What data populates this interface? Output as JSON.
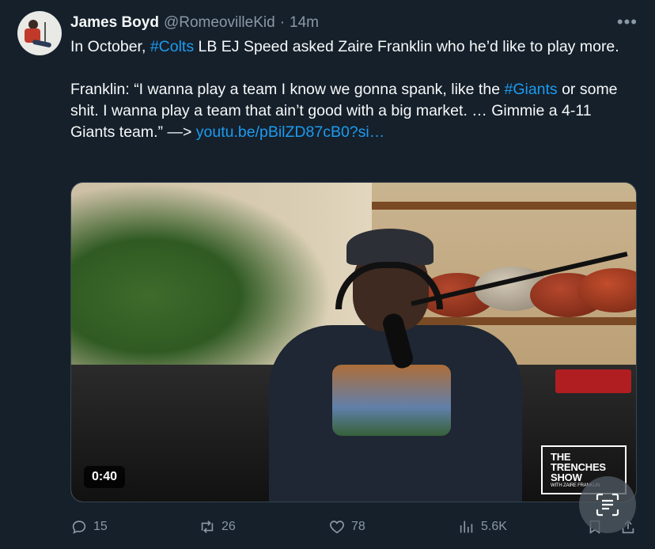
{
  "author": {
    "name": "James Boyd",
    "handle": "@RomeovilleKid",
    "separator": "·",
    "time": "14m"
  },
  "tweet": {
    "line1_prefix": "In October, ",
    "hashtag1": "#Colts",
    "line1_suffix": " LB EJ Speed asked Zaire Franklin who he’d like to play more.",
    "quote_prefix": "Franklin: “I wanna play a team I know we gonna spank, like the ",
    "hashtag2": "#Giants",
    "quote_suffix": " or some shit. I wanna play a team that ain’t good with a big market. … Gimmie a 4-11 Giants team.” —> ",
    "link": "youtu.be/pBilZD87cB0?si…"
  },
  "media": {
    "duration": "0:40",
    "watermark_title": "THE TRENCHES SHOW",
    "watermark_sub": "WITH ZAIRE FRANKLIN"
  },
  "actions": {
    "replies": "15",
    "retweets": "26",
    "likes": "78",
    "views": "5.6K"
  },
  "icons": {
    "more": "more-options-icon",
    "reply": "reply-icon",
    "retweet": "retweet-icon",
    "like": "heart-icon",
    "views": "views-icon",
    "bookmark": "bookmark-icon",
    "share": "share-icon",
    "text_recognition": "text-recognition-icon"
  },
  "colors": {
    "background": "#15202b",
    "text": "#f7f9f9",
    "muted": "#8b98a5",
    "link": "#1d9bf0"
  }
}
